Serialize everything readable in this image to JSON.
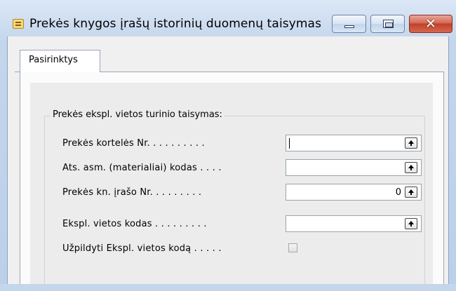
{
  "window": {
    "title": "Prekės knygos įrašų istorinių duomenų taisymas"
  },
  "tabs": [
    {
      "label": "Pasirinktys",
      "active": true
    }
  ],
  "group": {
    "label": "Prekės ekspl. vietos turinio taisymas:",
    "fields": [
      {
        "label": "Prekės kortelės Nr. . . . . . . . . .",
        "value": "",
        "has_lookup": true,
        "focused": true
      },
      {
        "label": "Ats. asm. (materialiai) kodas . . . .",
        "value": "",
        "has_lookup": true
      },
      {
        "label": "Prekės kn. įrašo Nr. . . . . . . . .",
        "value": "0",
        "has_lookup": true
      },
      {
        "label": "Ekspl. vietos kodas . . . . . . . . .",
        "value": "",
        "has_lookup": true
      }
    ],
    "checkbox": {
      "label": "Užpildyti Ekspl. vietos kodą . . . . .",
      "checked": false
    }
  },
  "colors": {
    "titlebar": "#c4d6ec",
    "close_button": "#c1412a",
    "panel": "#ececec"
  },
  "icons": {
    "app": "form-icon",
    "minimize": "minimize-icon",
    "maximize": "maximize-icon",
    "close": "close-icon",
    "lookup": "lookup-arrow-icon"
  }
}
